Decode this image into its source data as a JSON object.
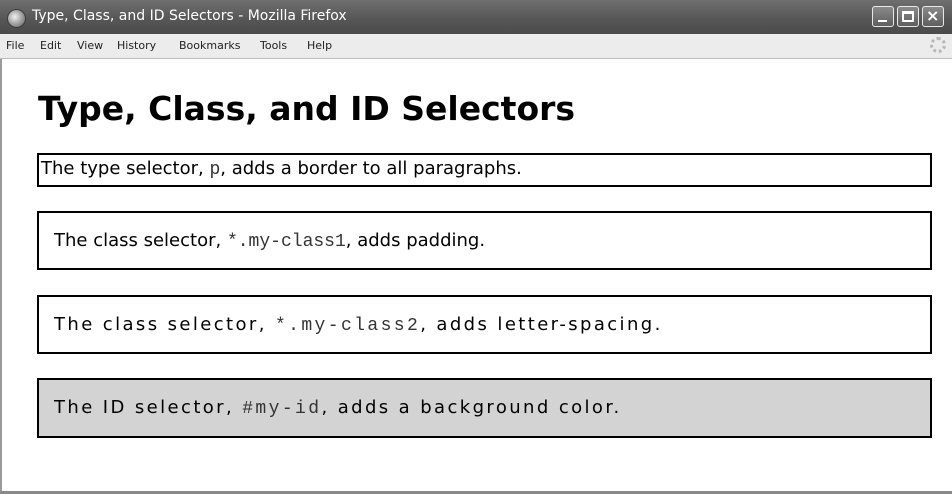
{
  "window": {
    "title": "Type, Class, and ID Selectors - Mozilla Firefox"
  },
  "menu": [
    "File",
    "Edit",
    "View",
    "History",
    "Bookmarks",
    "Tools",
    "Help"
  ],
  "page": {
    "heading": "Type, Class, and ID Selectors",
    "paragraphs": [
      {
        "before": "The type selector, ",
        "code": "p",
        "after": ", adds a border to all paragraphs."
      },
      {
        "before": "The class selector, ",
        "code": "*.my-class1",
        "after": ", adds padding."
      },
      {
        "before": "The class selector, ",
        "code": "*.my-class2",
        "after": ", adds letter-spacing."
      },
      {
        "before": "The ID selector, ",
        "code": "#my-id",
        "after": ", adds a background color."
      }
    ]
  },
  "colors": {
    "titlebar": "#575757",
    "menubar": "#ececec",
    "id_background": "#d3d3d3",
    "border": "#000000"
  }
}
